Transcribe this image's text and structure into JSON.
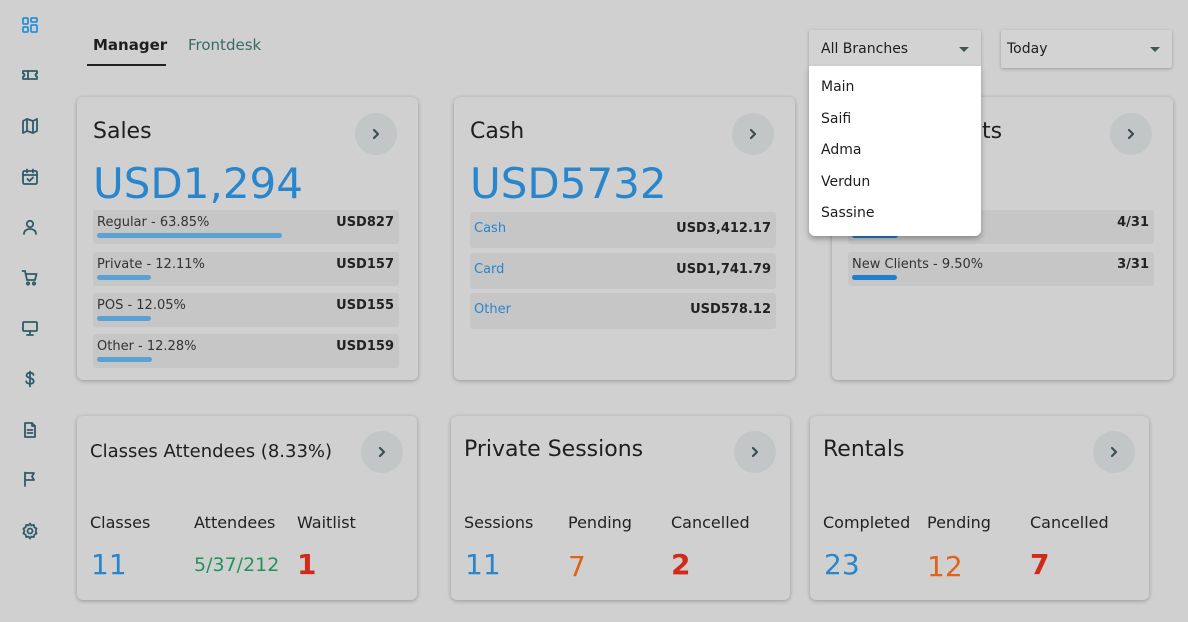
{
  "sidebar": {
    "icons": [
      "dashboard-icon",
      "ticket-icon",
      "map-icon",
      "calendar-check-icon",
      "user-icon",
      "cart-icon",
      "monitor-icon",
      "dollar-icon",
      "document-icon",
      "flag-icon",
      "settings-icon"
    ]
  },
  "tabs": {
    "manager": "Manager",
    "frontdesk": "Frontdesk"
  },
  "filters": {
    "branch": "All Branches",
    "date": "Today"
  },
  "branch_options": [
    "Main",
    "Saifi",
    "Adma",
    "Verdun",
    "Sassine"
  ],
  "sales": {
    "title": "Sales",
    "amount": "USD1,294",
    "rows": [
      {
        "label": "Regular - 63.85%",
        "value": "USD827",
        "fraction": 0.6385
      },
      {
        "label": "Private - 12.11%",
        "value": "USD157",
        "fraction": 0.1211
      },
      {
        "label": "POS - 12.05%",
        "value": "USD155",
        "fraction": 0.1205
      },
      {
        "label": "Other - 12.28%",
        "value": "USD159",
        "fraction": 0.1228
      }
    ]
  },
  "cash": {
    "title": "Cash",
    "amount": "USD5732",
    "rows": [
      {
        "label": "Cash",
        "value": "USD3,412.17"
      },
      {
        "label": "Card",
        "value": "USD1,741.79"
      },
      {
        "label": "Other",
        "value": "USD578.12"
      }
    ]
  },
  "clients": {
    "title_visible_fragment": "ts",
    "rows": [
      {
        "label": "",
        "value": "4/31",
        "fraction": 0.129
      },
      {
        "label": "New Clients - 9.50%",
        "value": "3/31",
        "fraction": 0.095
      }
    ]
  },
  "classes": {
    "title": "Classes Attendees (8.33%)",
    "labels": [
      "Classes",
      "Attendees",
      "Waitlist"
    ],
    "values": [
      "11",
      "5/37/212",
      "1"
    ]
  },
  "private_sessions": {
    "title": "Private Sessions",
    "labels": [
      "Sessions",
      "Pending",
      "Cancelled"
    ],
    "values": [
      "11",
      "7",
      "2"
    ]
  },
  "rentals": {
    "title": "Rentals",
    "labels": [
      "Completed",
      "Pending",
      "Cancelled"
    ],
    "values": [
      "23",
      "12",
      "7"
    ]
  },
  "colors": {
    "accent": "#2a86cc",
    "green": "#23925a",
    "red": "#d22a1a",
    "orange": "#e0621a"
  }
}
